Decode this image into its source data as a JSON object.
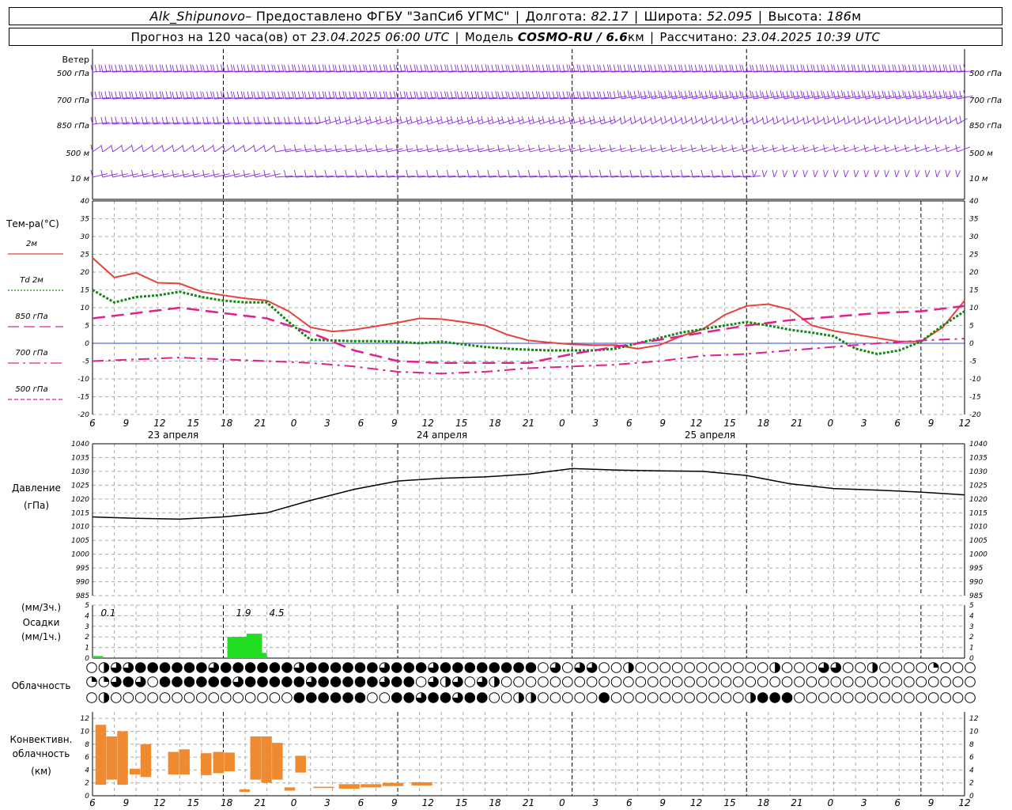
{
  "header": {
    "station": "Alk_Shipunovo",
    "provided_by": " – Предоставлено ФГБУ \"ЗапСиб УГМС\"",
    "lon_label": "Долгота:",
    "lon": "82.17",
    "lat_label": "Широта:",
    "lat": "52.095",
    "alt_label": "Высота:",
    "alt": "186",
    "alt_unit": "м",
    "forecast_label": "Прогноз на 120 часа(ов) от",
    "forecast_start": "23.04.2025 06:00 UTC",
    "model_label": "Модель",
    "model": "COSMO-RU / 6.6",
    "model_unit": "км",
    "calc_label": "Рассчитано:",
    "calc_time": "23.04.2025 10:39 UTC"
  },
  "wind": {
    "title": "Ветер",
    "levels": [
      "500 гПа",
      "700 гПа",
      "850 гПа",
      "500 м",
      "10 м"
    ],
    "color": "#8a2be2"
  },
  "temperature": {
    "title": "Тем-ра(°C)",
    "legend": [
      {
        "label": "2м",
        "color": "#e8413a"
      },
      {
        "label": "Td 2м",
        "color": "#118811"
      },
      {
        "label": "850 гПа",
        "color": "#e0208c"
      },
      {
        "label": "700 гПа",
        "color": "#e0208c"
      },
      {
        "label": "500 гПа",
        "color": "#e0208c"
      }
    ],
    "ticks": [
      "40",
      "35",
      "30",
      "25",
      "20",
      "15",
      "10",
      "5",
      "0",
      "-5",
      "-10",
      "-15",
      "-20"
    ]
  },
  "pressure": {
    "title": "Давление",
    "unit": "(гПа)",
    "ticks": [
      "1040",
      "1035",
      "1030",
      "1025",
      "1020",
      "1015",
      "1010",
      "1005",
      "1000",
      "995",
      "990",
      "985"
    ]
  },
  "precip": {
    "unit_top": "(мм/3ч.)",
    "title": "Осадки",
    "unit_bottom": "(мм/1ч.)",
    "ticks": [
      "5",
      "4",
      "3",
      "2",
      "1",
      "0"
    ],
    "labels": [
      "0.1",
      "1.9",
      "4.5"
    ],
    "color": "#22dd22"
  },
  "cloud": {
    "title": "Облачность"
  },
  "conv": {
    "title1": "Конвективн.",
    "title2": "облачность",
    "unit": "(км)",
    "ticks": [
      "12",
      "10",
      "8",
      "6",
      "4",
      "2",
      "0"
    ],
    "color": "#f08a30"
  },
  "time_axis": {
    "hours": [
      "6",
      "9",
      "12",
      "15",
      "18",
      "21",
      "0",
      "3",
      "6",
      "9",
      "12",
      "15",
      "18",
      "21",
      "0",
      "3",
      "6",
      "9",
      "12",
      "15",
      "18",
      "21",
      "0",
      "3",
      "6",
      "9",
      "12"
    ],
    "dates": [
      "23 апреля",
      "24 апреля",
      "25 апреля"
    ]
  },
  "chart_data": [
    {
      "type": "line",
      "title": "Тем-ра(°C)",
      "x_unit": "hours since 23.04.2025 06:00 UTC",
      "ylim": [
        -20,
        40
      ],
      "series": [
        {
          "name": "2м",
          "x": [
            0,
            3,
            6,
            9,
            12,
            15,
            18,
            21,
            24,
            27,
            30,
            33,
            36,
            39,
            42,
            45,
            48,
            51,
            54,
            57,
            60,
            63,
            66,
            69,
            72,
            75,
            78,
            81,
            84,
            87,
            90,
            93,
            96,
            99,
            102,
            105,
            108,
            111,
            114,
            117,
            120
          ],
          "values": [
            24,
            18.5,
            19.8,
            17,
            16.8,
            14.5,
            13.5,
            12.6,
            12,
            9,
            4.5,
            3.3,
            3.8,
            4.8,
            5.8,
            7,
            6.8,
            6,
            5,
            2.5,
            0.8,
            0.2,
            -0.3,
            -0.5,
            -0.5,
            -1.5,
            -0.5,
            2,
            4,
            8,
            10.5,
            11,
            9.5,
            5,
            3.5,
            2.5,
            1.5,
            0.5,
            0.5,
            4.5,
            12
          ]
        },
        {
          "name": "Td 2м",
          "x": [
            0,
            3,
            6,
            9,
            12,
            15,
            18,
            21,
            24,
            27,
            30,
            33,
            36,
            39,
            42,
            45,
            48,
            51,
            54,
            57,
            60,
            63,
            66,
            69,
            72,
            75,
            78,
            81,
            84,
            87,
            90,
            93,
            96,
            99,
            102,
            105,
            108,
            111,
            114,
            117,
            120
          ],
          "values": [
            15,
            11.5,
            13,
            13.5,
            14.5,
            13,
            12,
            11.5,
            11.5,
            6,
            1,
            0.8,
            0.6,
            0.6,
            0.5,
            0,
            0.5,
            -0.3,
            -1,
            -1.5,
            -1.8,
            -2,
            -2,
            -2,
            -1.5,
            0,
            1.5,
            3,
            4,
            5,
            6,
            5,
            3.8,
            3,
            2,
            -1.5,
            -3,
            -2,
            0.5,
            5,
            9
          ]
        },
        {
          "name": "850 гПа",
          "x": [
            0,
            6,
            12,
            18,
            24,
            30,
            36,
            42,
            48,
            54,
            60,
            66,
            72,
            78,
            84,
            90,
            96,
            102,
            108,
            114,
            120
          ],
          "values": [
            7,
            8.5,
            10,
            8.5,
            7,
            3,
            -2,
            -5,
            -5.5,
            -5.5,
            -5.5,
            -3,
            -1,
            1,
            3,
            5,
            6.5,
            7.5,
            8.5,
            9,
            10.5
          ]
        },
        {
          "name": "700 гПа",
          "x": [
            0,
            6,
            12,
            18,
            24,
            30,
            36,
            42,
            48,
            54,
            60,
            66,
            72,
            78,
            84,
            90,
            96,
            102,
            108,
            114,
            120
          ],
          "values": [
            -5,
            -4.5,
            -4,
            -4.5,
            -5,
            -5.5,
            -6.5,
            -8,
            -8.5,
            -8,
            -7,
            -6.5,
            -6,
            -5,
            -3.5,
            -3,
            -2,
            -1,
            0,
            0.8,
            1.3
          ]
        }
      ]
    },
    {
      "type": "line",
      "title": "Давление",
      "x_unit": "hours since 23.04.2025 06:00 UTC",
      "ylim": [
        985,
        1040
      ],
      "series": [
        {
          "name": "",
          "x": [
            0,
            6,
            12,
            18,
            24,
            30,
            36,
            42,
            48,
            54,
            60,
            66,
            72,
            78,
            84,
            90,
            96,
            102,
            108,
            114,
            120
          ],
          "values": [
            1013.5,
            1013,
            1012.7,
            1013.5,
            1015,
            1019.5,
            1023.5,
            1026.5,
            1027.5,
            1028,
            1029,
            1031,
            1030.5,
            1030.2,
            1030,
            1028.5,
            1025.5,
            1023.8,
            1023.2,
            1022.5,
            1021.5
          ]
        }
      ]
    },
    {
      "type": "bar",
      "title": "Осадки",
      "x_unit": "hours since 23.04.2025 06:00 UTC",
      "ylim": [
        0,
        5
      ],
      "x": [
        0,
        1,
        2,
        3,
        4,
        5,
        6,
        7,
        8,
        9,
        10,
        11,
        12,
        13,
        14,
        15,
        16,
        17,
        18,
        19,
        20,
        21,
        22,
        23,
        24,
        25,
        26,
        27,
        28,
        29,
        30,
        31,
        32,
        33,
        34,
        35,
        36
      ],
      "values": [
        0.2,
        0,
        0,
        0,
        0,
        0,
        0,
        0,
        0,
        0,
        0,
        0,
        0,
        0,
        0,
        0,
        0,
        0,
        0,
        0,
        0,
        0,
        0,
        0,
        0,
        0,
        0,
        0,
        2.0,
        2.0,
        2.0,
        2.0,
        2.3,
        2.3,
        0.5,
        0,
        0
      ]
    },
    {
      "type": "bar",
      "title": "Конвективн. облачность",
      "x_unit": "hours since 23.04.2025 06:00 UTC",
      "ylim": [
        0,
        12
      ],
      "bars": [
        {
          "x": 0.5,
          "bottom": 1.7,
          "top": 11
        },
        {
          "x": 2,
          "bottom": 2.5,
          "top": 9.2
        },
        {
          "x": 3.5,
          "bottom": 1.7,
          "top": 10
        },
        {
          "x": 5.2,
          "bottom": 3.3,
          "top": 4.2
        },
        {
          "x": 6.7,
          "bottom": 2.9,
          "top": 8
        },
        {
          "x": 10.5,
          "bottom": 3.3,
          "top": 6.8
        },
        {
          "x": 12,
          "bottom": 3.3,
          "top": 7.2
        },
        {
          "x": 15,
          "bottom": 3.2,
          "top": 6.6
        },
        {
          "x": 16.7,
          "bottom": 3.5,
          "top": 6.8
        },
        {
          "x": 18.2,
          "bottom": 3.8,
          "top": 6.7
        },
        {
          "x": 20.3,
          "bottom": 0.6,
          "top": 1
        },
        {
          "x": 21.8,
          "bottom": 2.5,
          "top": 9.2
        },
        {
          "x": 23.3,
          "bottom": 2.0,
          "top": 9.2
        },
        {
          "x": 24.8,
          "bottom": 2.5,
          "top": 8.2
        },
        {
          "x": 26.5,
          "bottom": 0.8,
          "top": 1.3
        },
        {
          "x": 28,
          "bottom": 3.6,
          "top": 6.2
        },
        {
          "x": 30.5,
          "bottom": 1.2,
          "top": 1.4
        },
        {
          "x": 34,
          "bottom": 1.1,
          "top": 1.8
        },
        {
          "x": 37,
          "bottom": 1.3,
          "top": 1.8
        },
        {
          "x": 40,
          "bottom": 1.5,
          "top": 2.0
        },
        {
          "x": 44,
          "bottom": 1.6,
          "top": 2.1
        }
      ]
    }
  ]
}
